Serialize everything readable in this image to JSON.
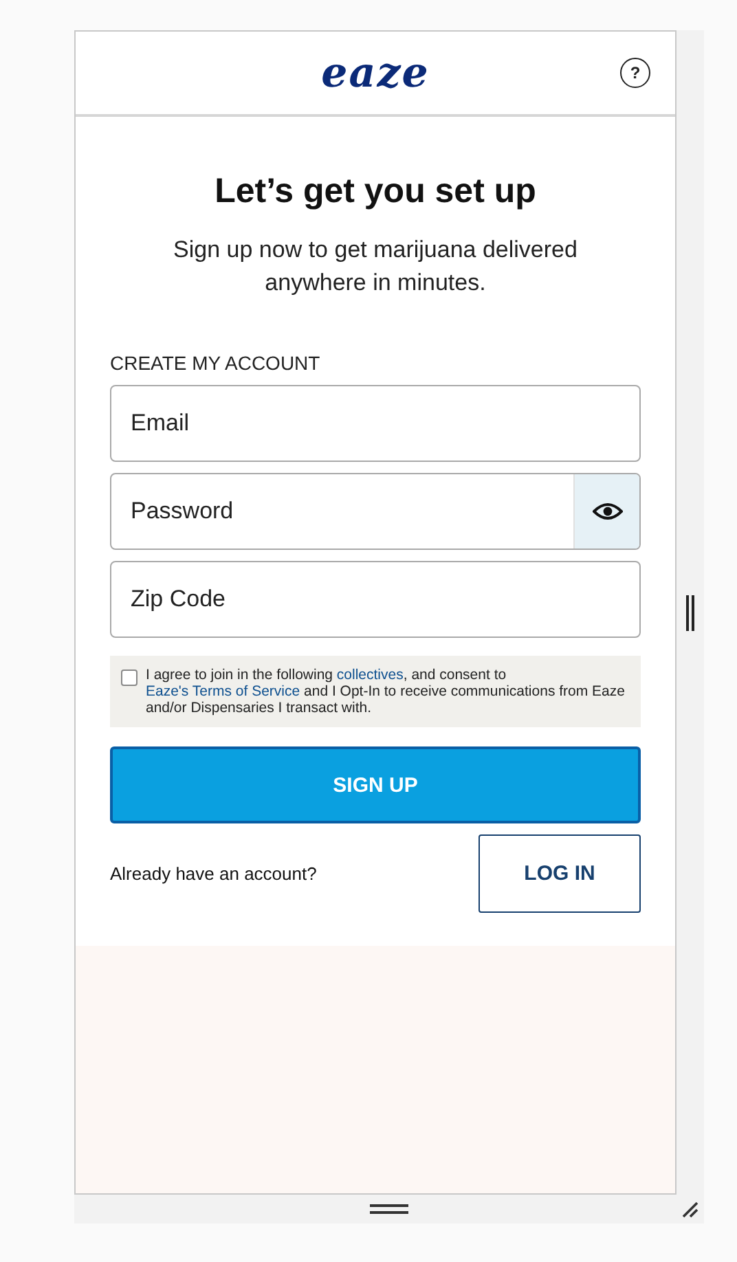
{
  "header": {
    "logo": "eaze",
    "help_icon": "?"
  },
  "heading": "Let’s get you set up",
  "subtitle": "Sign up now to get marijuana delivered anywhere in minutes.",
  "section_label": "CREATE MY ACCOUNT",
  "fields": [
    {
      "kind": "text",
      "placeholder": "Email"
    },
    {
      "kind": "password",
      "placeholder": "Password"
    },
    {
      "kind": "text",
      "placeholder": "Zip Code"
    }
  ],
  "consent": {
    "checked": false,
    "parts": [
      {
        "kind": "text",
        "text": "I agree to join in the following "
      },
      {
        "kind": "link",
        "text": "collectives"
      },
      {
        "kind": "text",
        "text": ", and consent to "
      },
      {
        "kind": "link",
        "text": "Eaze's Terms of Service"
      },
      {
        "kind": "text",
        "text": " and I Opt-In to receive communications from Eaze and/or Dispensaries I transact with."
      }
    ]
  },
  "signup_button": "SIGN UP",
  "login_prompt": "Already have an account?",
  "login_button": "LOG IN"
}
